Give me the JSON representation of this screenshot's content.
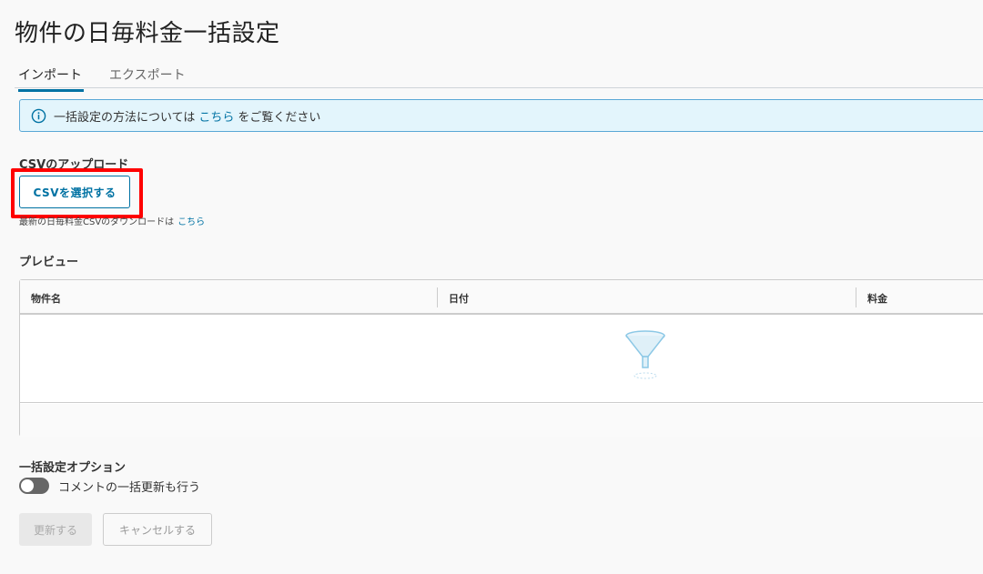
{
  "page": {
    "title": "物件の日毎料金一括設定"
  },
  "tabs": [
    {
      "label": "インポート",
      "active": true
    },
    {
      "label": "エクスポート",
      "active": false
    }
  ],
  "alert": {
    "text_before": "一括設定の方法については",
    "link": "こちら",
    "text_after": "をご覧ください",
    "icon": "info-icon"
  },
  "upload": {
    "label": "CSVのアップロード",
    "button": "CSVを選択する",
    "download_note": "最新の日毎料金CSVのダウンロードは",
    "download_link": "こちら"
  },
  "preview": {
    "label": "プレビュー",
    "columns": [
      "物件名",
      "日付",
      "料金"
    ],
    "rows": [],
    "empty_icon": "funnel-icon"
  },
  "options": {
    "title": "一括設定オプション",
    "toggle_label": "コメントの一括更新も行う",
    "toggle_on": false
  },
  "actions": {
    "update": "更新する",
    "cancel": "キャンセルする"
  },
  "colors": {
    "accent": "#0072a3",
    "highlight": "#ff0000",
    "alert_bg": "#e3f5fc"
  }
}
